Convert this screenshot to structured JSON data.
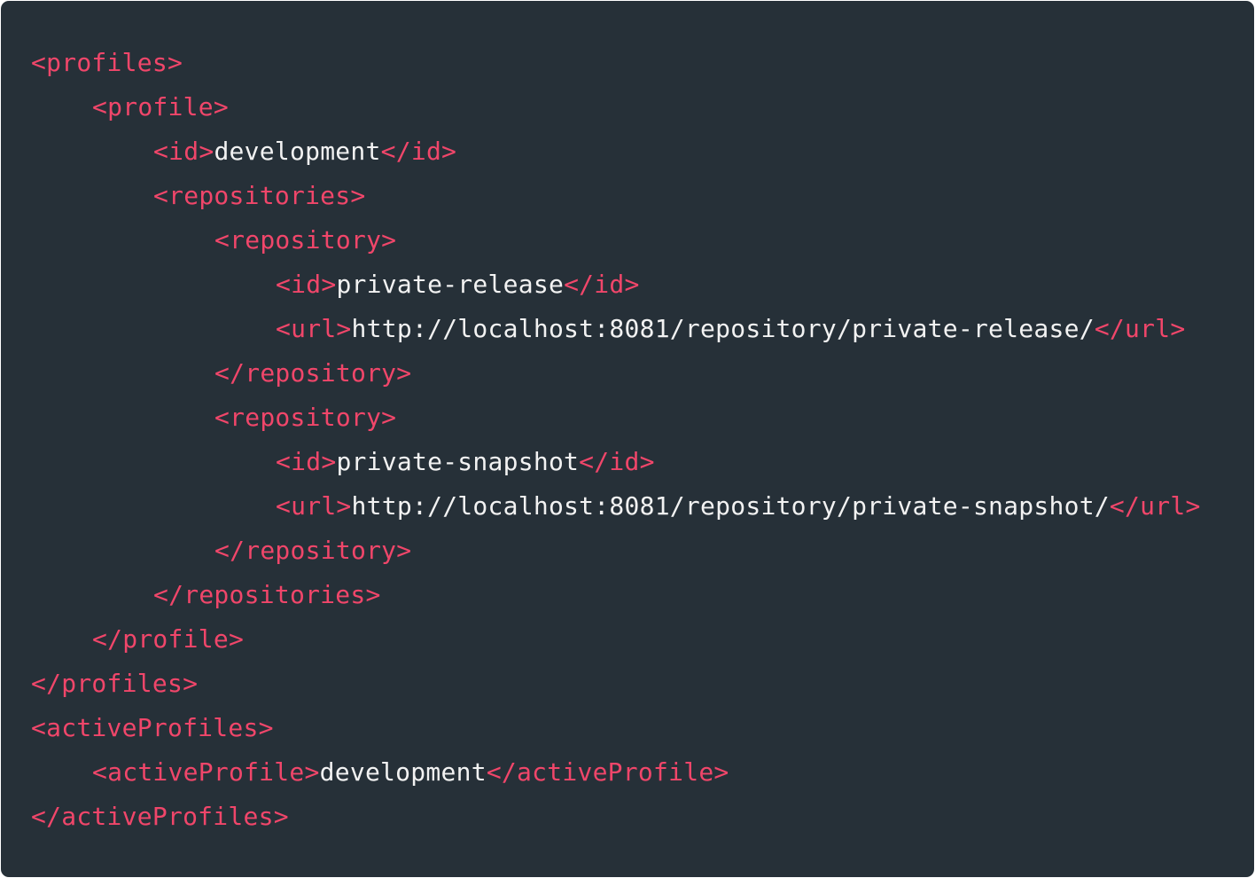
{
  "colors": {
    "background": "#263038",
    "tag": "#f0466a",
    "text": "#f2f2f2"
  },
  "code": {
    "language": "xml",
    "lines": [
      {
        "indent": 0,
        "tokens": [
          {
            "kind": "tag",
            "text": "<profiles>"
          }
        ]
      },
      {
        "indent": 1,
        "tokens": [
          {
            "kind": "tag",
            "text": "<profile>"
          }
        ]
      },
      {
        "indent": 2,
        "tokens": [
          {
            "kind": "tag",
            "text": "<id>"
          },
          {
            "kind": "text",
            "text": "development"
          },
          {
            "kind": "tag",
            "text": "</id>"
          }
        ]
      },
      {
        "indent": 2,
        "tokens": [
          {
            "kind": "tag",
            "text": "<repositories>"
          }
        ]
      },
      {
        "indent": 3,
        "tokens": [
          {
            "kind": "tag",
            "text": "<repository>"
          }
        ]
      },
      {
        "indent": 4,
        "tokens": [
          {
            "kind": "tag",
            "text": "<id>"
          },
          {
            "kind": "text",
            "text": "private-release"
          },
          {
            "kind": "tag",
            "text": "</id>"
          }
        ]
      },
      {
        "indent": 4,
        "tokens": [
          {
            "kind": "tag",
            "text": "<url>"
          },
          {
            "kind": "text",
            "text": "http://localhost:8081/repository/private-release/"
          },
          {
            "kind": "tag",
            "text": "</url>"
          }
        ]
      },
      {
        "indent": 3,
        "tokens": [
          {
            "kind": "tag",
            "text": "</repository>"
          }
        ]
      },
      {
        "indent": 3,
        "tokens": [
          {
            "kind": "tag",
            "text": "<repository>"
          }
        ]
      },
      {
        "indent": 4,
        "tokens": [
          {
            "kind": "tag",
            "text": "<id>"
          },
          {
            "kind": "text",
            "text": "private-snapshot"
          },
          {
            "kind": "tag",
            "text": "</id>"
          }
        ]
      },
      {
        "indent": 4,
        "tokens": [
          {
            "kind": "tag",
            "text": "<url>"
          },
          {
            "kind": "text",
            "text": "http://localhost:8081/repository/private-snapshot/"
          },
          {
            "kind": "tag",
            "text": "</url>"
          }
        ]
      },
      {
        "indent": 3,
        "tokens": [
          {
            "kind": "tag",
            "text": "</repository>"
          }
        ]
      },
      {
        "indent": 2,
        "tokens": [
          {
            "kind": "tag",
            "text": "</repositories>"
          }
        ]
      },
      {
        "indent": 1,
        "tokens": [
          {
            "kind": "tag",
            "text": "</profile>"
          }
        ]
      },
      {
        "indent": 0,
        "tokens": [
          {
            "kind": "tag",
            "text": "</profiles>"
          }
        ]
      },
      {
        "indent": 0,
        "tokens": [
          {
            "kind": "tag",
            "text": "<activeProfiles>"
          }
        ]
      },
      {
        "indent": 1,
        "tokens": [
          {
            "kind": "tag",
            "text": "<activeProfile>"
          },
          {
            "kind": "text",
            "text": "development"
          },
          {
            "kind": "tag",
            "text": "</activeProfile>"
          }
        ]
      },
      {
        "indent": 0,
        "tokens": [
          {
            "kind": "tag",
            "text": "</activeProfiles>"
          }
        ]
      }
    ]
  }
}
